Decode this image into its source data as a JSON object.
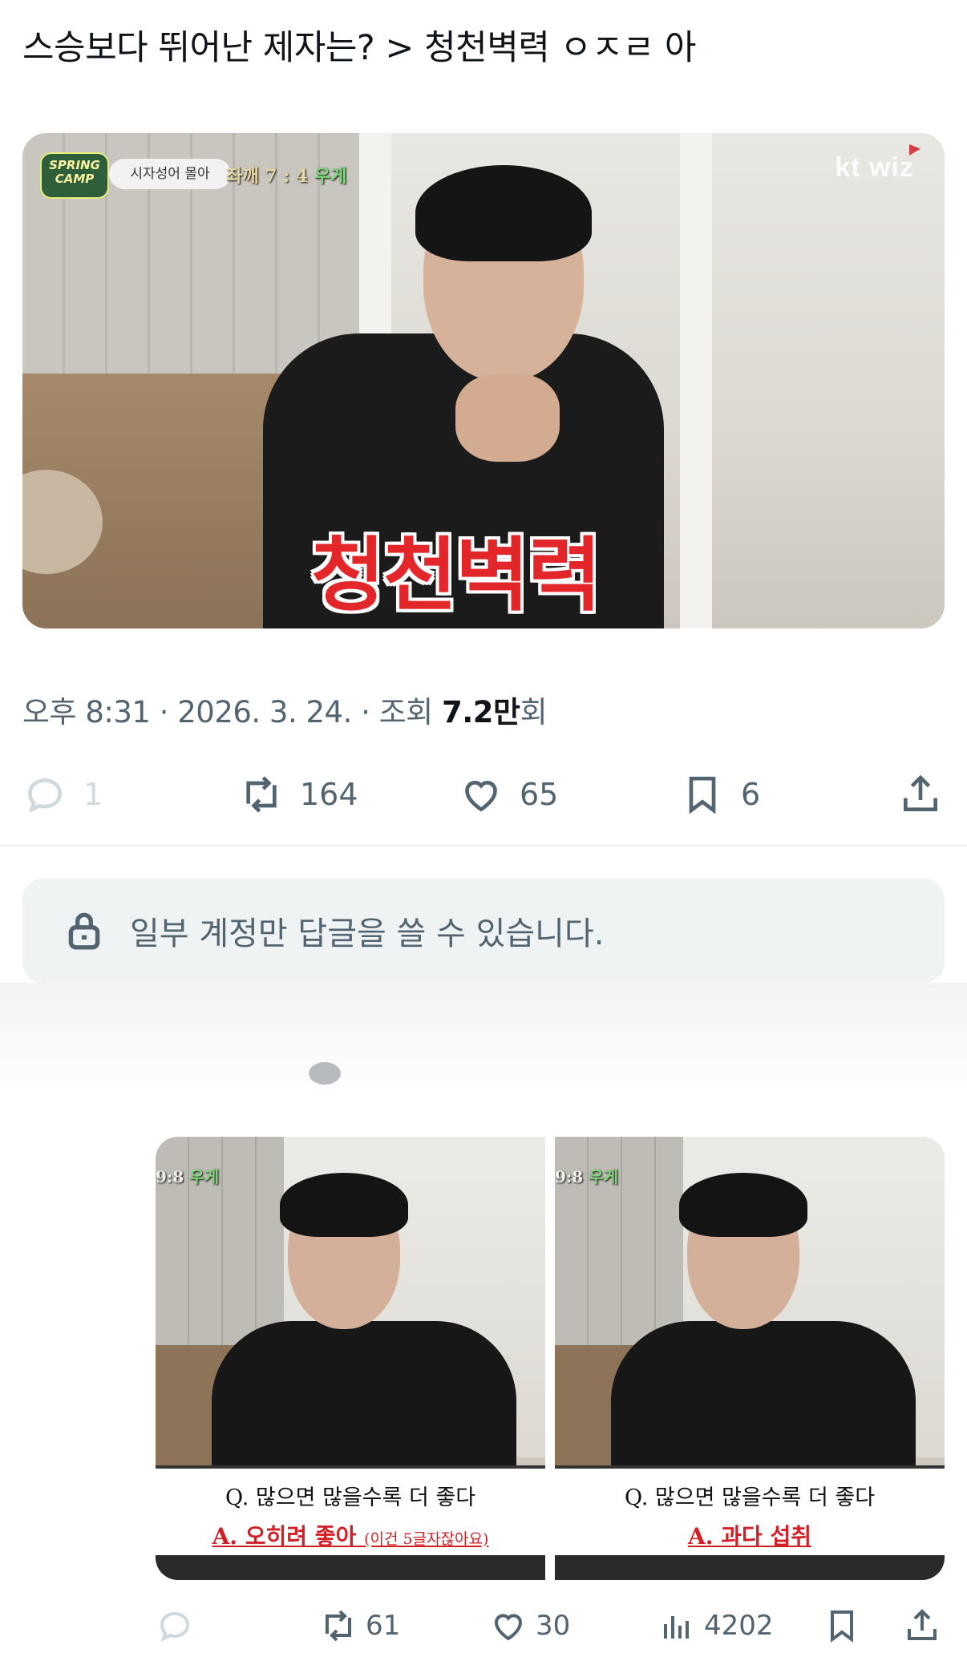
{
  "tweet": {
    "text": "스승보다 뛰어난 제자는? > 청천벽력 ㅇㅈㄹ 아"
  },
  "media": {
    "badge_camp": "SPRING CAMP",
    "badge_pill": "시자성어 몰아",
    "score_text": "좌깨 7 : 4",
    "score_suffix": "우게",
    "logo": "kt wiz",
    "caption": "청천벽력"
  },
  "meta": {
    "time": "오후 8:31",
    "date": "2026. 3. 24.",
    "views_label": "조회",
    "views_number": "7.2만",
    "views_suffix": "회"
  },
  "actions": {
    "reply_count": "1",
    "retweet_count": "164",
    "like_count": "65",
    "bookmark_count": "6"
  },
  "reply_box": {
    "text": "일부 계정만 답글을 쓸 수 있습니다."
  },
  "quoted_media": [
    {
      "score": "9:8",
      "score_suffix": "우게",
      "question": "Q. 많으면 많을수록 더 좋다",
      "answer": "A. 오히려 좋아",
      "answer_note": "(이건 5글자잖아요)"
    },
    {
      "score": "9:8",
      "score_suffix": "우게",
      "question": "Q. 많으면 많을수록 더 좋다",
      "answer": "A. 과다 섭취",
      "answer_note": ""
    }
  ],
  "sub_actions": {
    "retweet_count": "61",
    "like_count": "30",
    "view_count": "4202"
  },
  "icons": {
    "reply": "reply-icon",
    "retweet": "retweet-icon",
    "like": "heart-icon",
    "bookmark": "bookmark-icon",
    "share": "share-icon",
    "lock": "lock-icon",
    "views": "bar-chart-icon"
  },
  "colors": {
    "text": "#0f1419",
    "secondary": "#536471",
    "caption_red": "#e3262a"
  }
}
